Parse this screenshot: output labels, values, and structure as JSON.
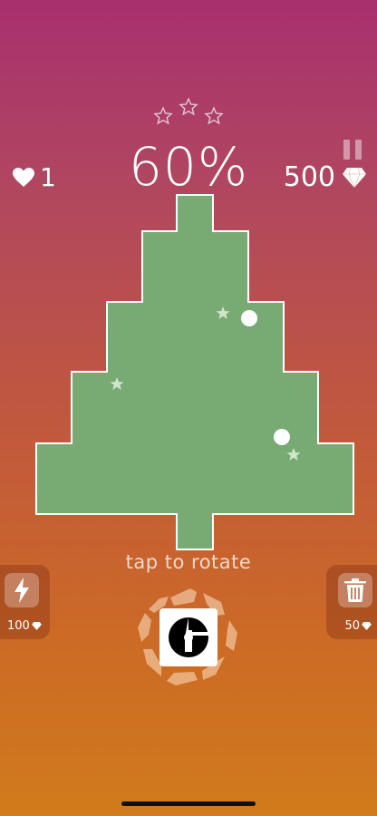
{
  "hud": {
    "stars_total": 3,
    "stars_earned": 0,
    "progress": "60%",
    "lives": "1",
    "gems": "500"
  },
  "hint": "tap to rotate",
  "powerups": {
    "lightning": {
      "icon": "lightning-icon",
      "price": "100"
    },
    "trash": {
      "icon": "trash-icon",
      "price": "50"
    }
  },
  "colors": {
    "board_fill": "#78aa74",
    "board_stroke": "#ffffff",
    "accent": "#ffffff"
  }
}
